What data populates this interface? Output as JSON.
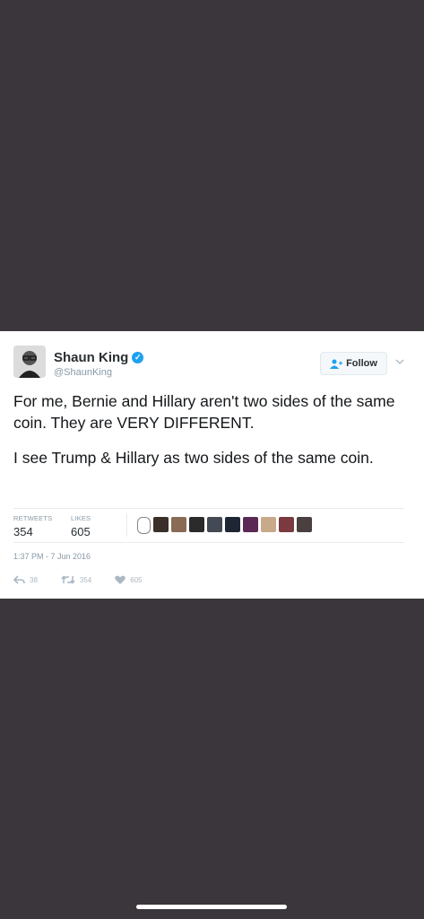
{
  "tweet": {
    "author_name": "Shaun King",
    "author_handle": "@ShaunKing",
    "follow_label": "Follow",
    "paragraphs": [
      "For me, Bernie and Hillary aren't two sides of the same coin. They are VERY DIFFERENT.",
      "I see Trump & Hillary as two sides of the same coin."
    ],
    "stats": {
      "retweets_label": "RETWEETS",
      "retweets_value": "354",
      "likes_label": "LIKES",
      "likes_value": "605"
    },
    "timestamp": "1:37 PM - 7 Jun 2016",
    "actions": {
      "reply_count": "38",
      "retweet_count": "354",
      "like_count": "605"
    }
  },
  "colors": {
    "background": "#3b363c",
    "verified": "#1da1f2",
    "muted": "#8899a6"
  }
}
